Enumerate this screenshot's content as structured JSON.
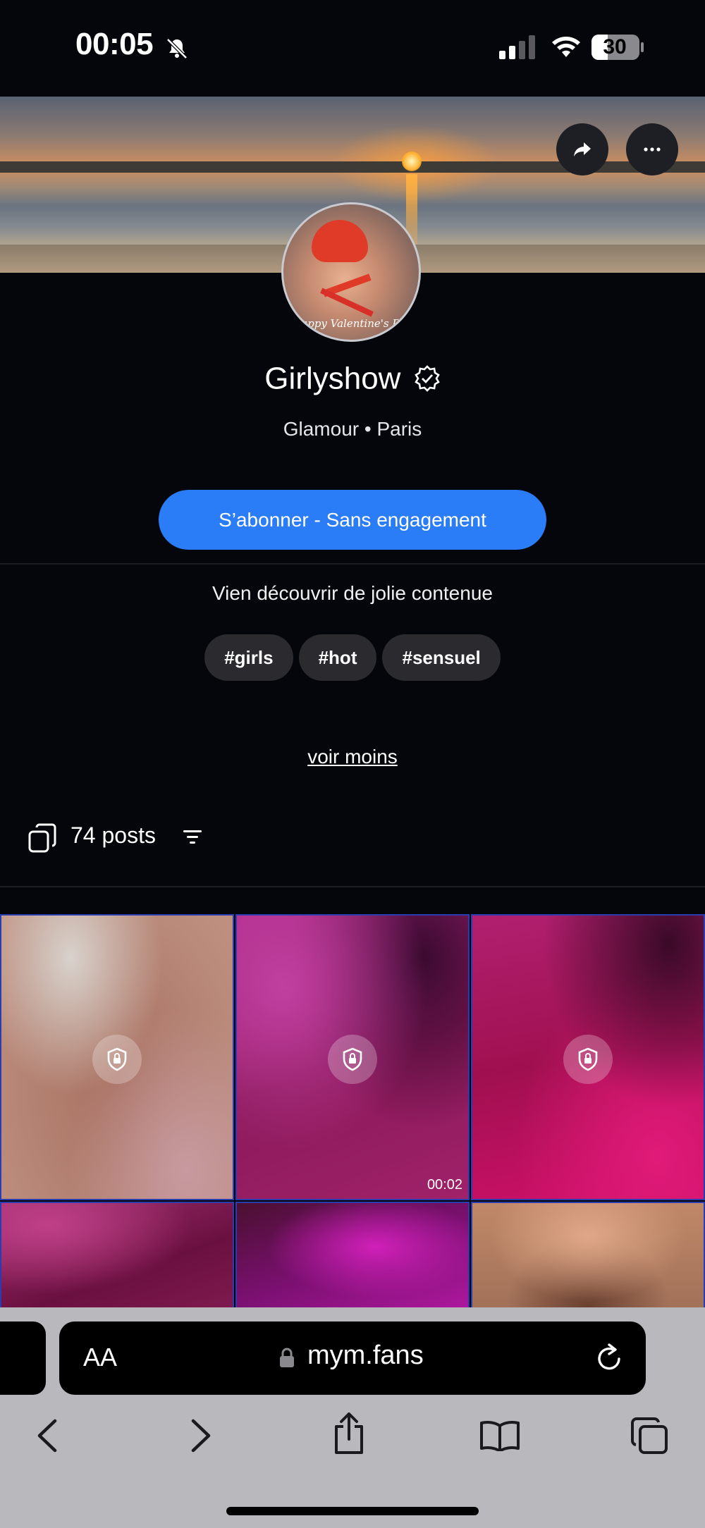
{
  "status_bar": {
    "time": "00:05",
    "battery": "30"
  },
  "profile": {
    "name": "Girlyshow",
    "location": "Glamour • Paris",
    "avatar_caption": "Happy Valentine's Day",
    "subscribe_label": "S’abonner - Sans engagement",
    "bio": "Vien découvrir de jolie contenue",
    "tags": [
      "#girls",
      "#hot",
      "#sensuel"
    ],
    "toggle_label": "voir moins"
  },
  "posts": {
    "count_label": "74 posts",
    "tiles": [
      {
        "locked": true,
        "duration": ""
      },
      {
        "locked": true,
        "duration": "00:02"
      },
      {
        "locked": true,
        "duration": ""
      },
      {
        "locked": false,
        "duration": ""
      },
      {
        "locked": false,
        "duration": ""
      },
      {
        "locked": false,
        "duration": ""
      }
    ]
  },
  "browser": {
    "aa_label": "AA",
    "url": "mym.fans"
  },
  "colors": {
    "accent": "#2a7cf7",
    "background": "#05060c",
    "safari_bar": "#b9b9bd"
  },
  "icons": [
    "bell-slash-icon",
    "signal-icon",
    "wifi-icon",
    "battery-icon",
    "share-icon",
    "ellipsis-icon",
    "verified-icon",
    "posts-stack-icon",
    "filter-icon",
    "lock-icon",
    "reload-icon",
    "back-icon",
    "forward-icon",
    "share-sheet-icon",
    "bookmarks-icon",
    "tabs-icon"
  ]
}
